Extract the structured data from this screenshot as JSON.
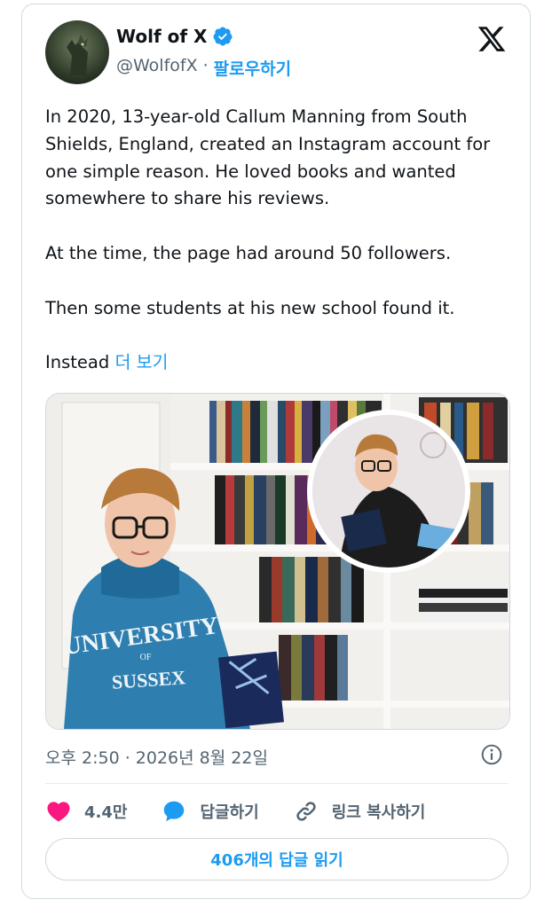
{
  "author": {
    "name": "Wolf of X",
    "handle": "@WolfofX",
    "separator": "·",
    "follow_label": "팔로우하기"
  },
  "tweet": {
    "paragraphs": [
      "In 2020, 13-year-old Callum Manning from South Shields, England, created an Instagram account for one simple reason. He loved books and wanted somewhere to share his reviews.",
      "At the time, the page had around 50 followers.",
      "Then some students at his new school found it."
    ],
    "last_text": "Instead",
    "show_more": "더 보기"
  },
  "media": {
    "hoodie_text": "UNIVERSITY OF SUSSEX"
  },
  "timestamp": "오후 2:50 · 2026년 8월 22일",
  "actions": {
    "likes": "4.4만",
    "reply_label": "답글하기",
    "copy_link_label": "링크 복사하기"
  },
  "read_replies_label": "406개의 답글 읽기",
  "colors": {
    "accent": "#1d9bf0",
    "like": "#f91880",
    "text": "#0f1419",
    "secondary": "#536471"
  },
  "icons": [
    "verified-badge-icon",
    "x-logo-icon",
    "info-icon",
    "heart-icon",
    "reply-bubble-icon",
    "link-icon"
  ]
}
